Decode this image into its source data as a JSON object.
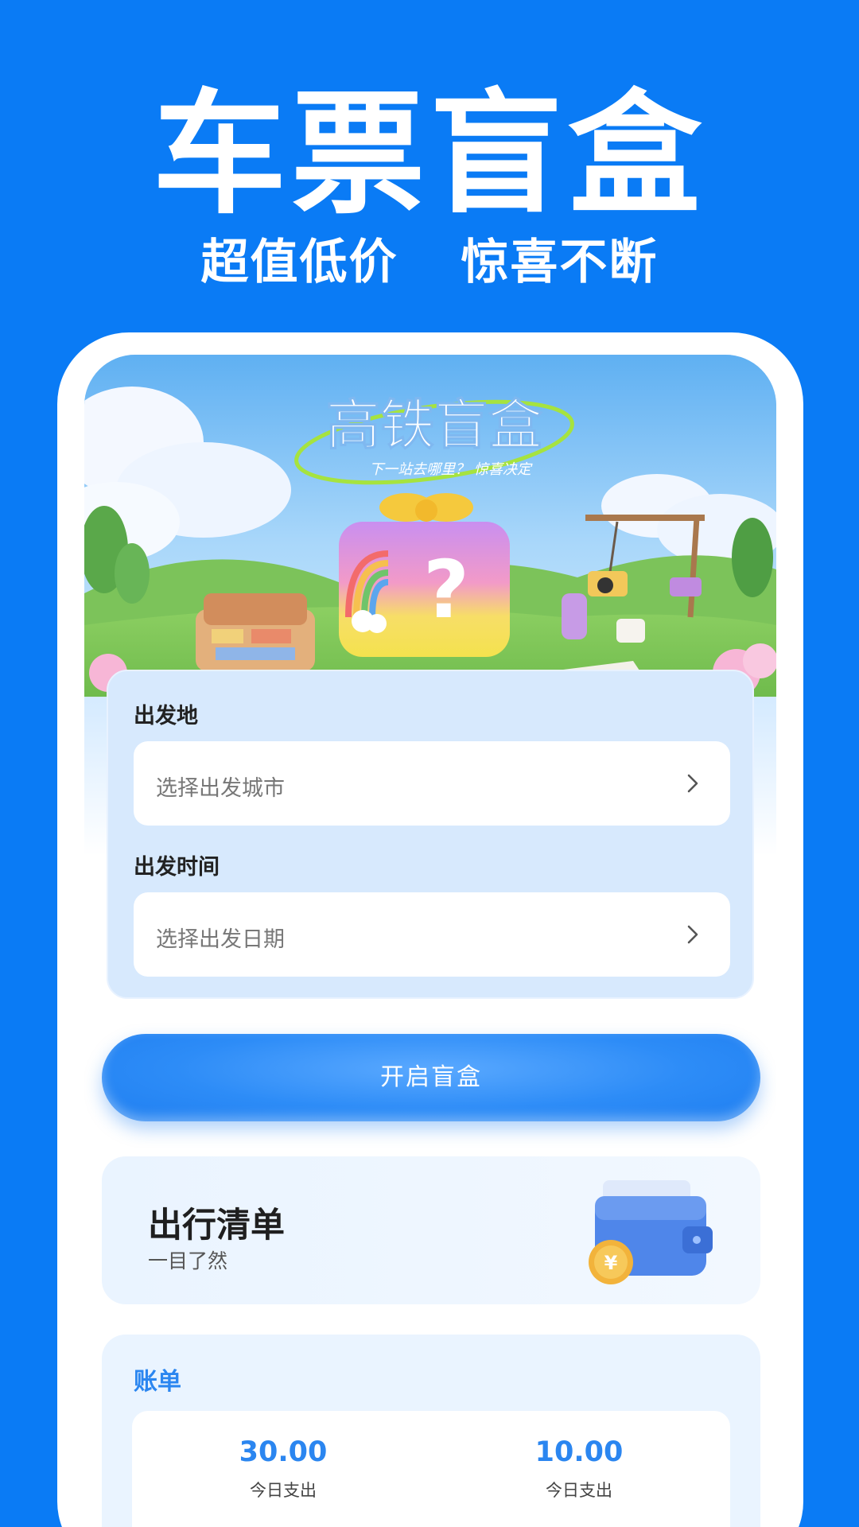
{
  "hero": {
    "title": "车票盲盒",
    "subtitle_left": "超值低价",
    "subtitle_right": "惊喜不断"
  },
  "banner": {
    "logo_text": "高铁盲盒",
    "tagline": "下一站去哪里？ 惊喜决定"
  },
  "form": {
    "departure_label": "出发地",
    "departure_placeholder": "选择出发城市",
    "time_label": "出发时间",
    "time_placeholder": "选择出发日期"
  },
  "actions": {
    "open_box_label": "开启盲盒"
  },
  "trip_list": {
    "title": "出行清单",
    "subtitle": "一目了然"
  },
  "bill": {
    "title": "账单",
    "items": [
      {
        "amount": "30.00",
        "label": "今日支出"
      },
      {
        "amount": "10.00",
        "label": "今日支出"
      }
    ]
  },
  "colors": {
    "brand_blue": "#0a7bf5",
    "accent_blue": "#2b86f0"
  },
  "icons": [
    "chevron-right-icon",
    "wallet-coin-icon"
  ]
}
